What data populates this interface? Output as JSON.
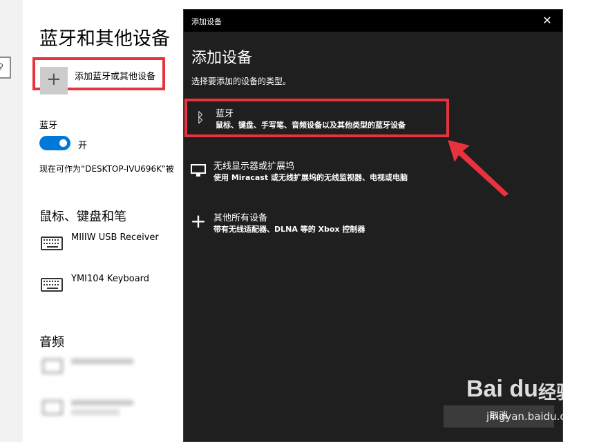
{
  "settings": {
    "title": "蓝牙和其他设备",
    "add_device_label": "添加蓝牙或其他设备",
    "bluetooth_label": "蓝牙",
    "bluetooth_state": "开",
    "discoverable_text": "现在可作为“DESKTOP-IVU696K”被",
    "mouse_section": "鼠标、键盘和笔",
    "devices": [
      {
        "name": "MIIIW USB Receiver",
        "icon": "keyboard-icon"
      },
      {
        "name": "YMI104 Keyboard",
        "icon": "keyboard-icon"
      }
    ],
    "audio_section": "音频"
  },
  "dialog": {
    "window_title": "添加设备",
    "heading": "添加设备",
    "subtitle": "选择要添加的设备的类型。",
    "close_glyph": "✕",
    "options": [
      {
        "name": "蓝牙",
        "desc": "鼠标、键盘、手写笔、音频设备以及其他类型的蓝牙设备",
        "icon": "bluetooth-icon",
        "selected": true
      },
      {
        "name": "无线显示器或扩展坞",
        "desc": "使用 Miracast 或无线扩展坞的无线监视器、电视或电脑",
        "icon": "monitor-icon",
        "selected": false
      },
      {
        "name": "其他所有设备",
        "desc": "带有无线适配器、DLNA 等的 Xbox 控制器",
        "icon": "plus-icon",
        "selected": false
      }
    ],
    "cancel_label": "取消"
  },
  "watermark": {
    "logo": "Bai du",
    "suffix": "经验",
    "url": "jingyan.baidu.com"
  },
  "colors": {
    "accent": "#0078d7",
    "highlight_box": "#e8333f",
    "dialog_bg": "#1f1f1f",
    "titlebar_bg": "#000000"
  }
}
